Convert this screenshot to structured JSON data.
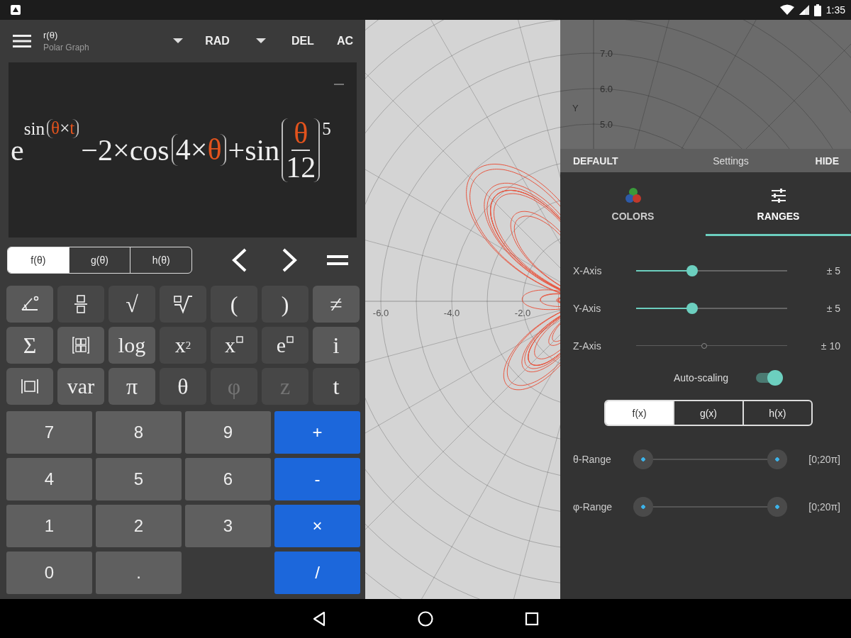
{
  "status_bar": {
    "time": "1:35"
  },
  "toolbar": {
    "title": "r(θ)",
    "subtitle": "Polar Graph",
    "angle_mode": "RAD",
    "delete_label": "DEL",
    "clear_label": "AC"
  },
  "expression": [
    {
      "kind": "text",
      "text": "e"
    },
    {
      "kind": "sup",
      "children": [
        {
          "kind": "text",
          "text": "sin"
        },
        {
          "kind": "paren",
          "children": [
            {
              "kind": "var",
              "text": "θ"
            },
            {
              "kind": "text",
              "text": "×"
            },
            {
              "kind": "var",
              "text": "t"
            }
          ]
        }
      ]
    },
    {
      "kind": "text",
      "text": "−2×cos"
    },
    {
      "kind": "paren",
      "children": [
        {
          "kind": "text",
          "text": "4×"
        },
        {
          "kind": "var",
          "text": "θ"
        }
      ]
    },
    {
      "kind": "text",
      "text": "+sin"
    },
    {
      "kind": "paren",
      "children": [
        {
          "kind": "frac",
          "numerator": [
            {
              "kind": "var",
              "text": "θ"
            }
          ],
          "denominator": [
            {
              "kind": "text",
              "text": "12"
            }
          ]
        }
      ]
    },
    {
      "kind": "sup",
      "children": [
        {
          "kind": "text",
          "text": "5"
        }
      ]
    }
  ],
  "function_tabs": [
    {
      "label": "f(θ)",
      "selected": true
    },
    {
      "label": "g(θ)",
      "selected": false
    },
    {
      "label": "h(θ)",
      "selected": false
    }
  ],
  "function_keys": [
    {
      "kind": "angle",
      "highlighted": true,
      "disabled": false
    },
    {
      "kind": "fraction",
      "highlighted": false,
      "disabled": false
    },
    {
      "kind": "text",
      "label": "√",
      "highlighted": false,
      "disabled": false
    },
    {
      "kind": "root",
      "highlighted": false,
      "disabled": false
    },
    {
      "kind": "text",
      "label": "(",
      "highlighted": false,
      "disabled": false
    },
    {
      "kind": "text",
      "label": ")",
      "highlighted": false,
      "disabled": false
    },
    {
      "kind": "text",
      "label": "≠",
      "highlighted": true,
      "disabled": false
    },
    {
      "kind": "text",
      "label": "Σ",
      "highlighted": true,
      "disabled": false
    },
    {
      "kind": "matrix",
      "highlighted": true,
      "disabled": false
    },
    {
      "kind": "text",
      "label": "log",
      "highlighted": true,
      "disabled": false
    },
    {
      "kind": "text",
      "label": "x$^{2}$",
      "highlighted": false,
      "disabled": false
    },
    {
      "kind": "power",
      "label": "x",
      "highlighted": false,
      "disabled": false
    },
    {
      "kind": "power",
      "label": "e",
      "highlighted": false,
      "disabled": false
    },
    {
      "kind": "text",
      "label": "i",
      "highlighted": true,
      "disabled": false
    },
    {
      "kind": "abs",
      "highlighted": true,
      "disabled": false
    },
    {
      "kind": "text",
      "label": "var",
      "highlighted": true,
      "disabled": false
    },
    {
      "kind": "text",
      "label": "π",
      "highlighted": true,
      "disabled": false
    },
    {
      "kind": "text",
      "label": "θ",
      "highlighted": false,
      "disabled": false
    },
    {
      "kind": "text",
      "label": "φ",
      "highlighted": false,
      "disabled": true
    },
    {
      "kind": "text",
      "label": "z",
      "highlighted": false,
      "disabled": true
    },
    {
      "kind": "text",
      "label": "t",
      "highlighted": false,
      "disabled": false
    }
  ],
  "digit_keys": [
    "7",
    "8",
    "9",
    "4",
    "5",
    "6",
    "1",
    "2",
    "3",
    "0",
    "."
  ],
  "operator_keys": [
    "+",
    "-",
    "×",
    "/"
  ],
  "graph": {
    "x_tick_labels": [
      "-6.0",
      "-4.0",
      "-2.0"
    ],
    "y_tick_labels": [
      "7.0",
      "6.0",
      "5.0"
    ],
    "y_axis_label": "Y"
  },
  "settings": {
    "header": {
      "default_label": "DEFAULT",
      "title": "Settings",
      "hide_label": "HIDE"
    },
    "tabs": [
      {
        "kind": "colors",
        "label": "COLORS",
        "selected": false
      },
      {
        "kind": "ranges",
        "label": "RANGES",
        "selected": true
      }
    ],
    "axis_sliders": [
      {
        "label": "X-Axis",
        "level": 0.37,
        "disabled": false,
        "reading": "± 5"
      },
      {
        "label": "Y-Axis",
        "level": 0.37,
        "disabled": false,
        "reading": "± 5"
      },
      {
        "label": "Z-Axis",
        "level": 0.45,
        "disabled": true,
        "reading": "± 10"
      }
    ],
    "auto_scaling": {
      "label": "Auto-scaling",
      "on": true
    },
    "function_tabs": [
      {
        "label": "f(x)",
        "selected": true
      },
      {
        "label": "g(x)",
        "selected": false
      },
      {
        "label": "h(x)",
        "selected": false
      }
    ],
    "range_sliders": [
      {
        "label": "θ-Range",
        "thumbs": [
          {
            "level": 0
          },
          {
            "level": 1
          }
        ],
        "reading": "[0;20π]"
      },
      {
        "label": "φ-Range",
        "thumbs": [
          {
            "level": 0
          },
          {
            "level": 1
          }
        ],
        "reading": "[0;20π]"
      }
    ]
  }
}
